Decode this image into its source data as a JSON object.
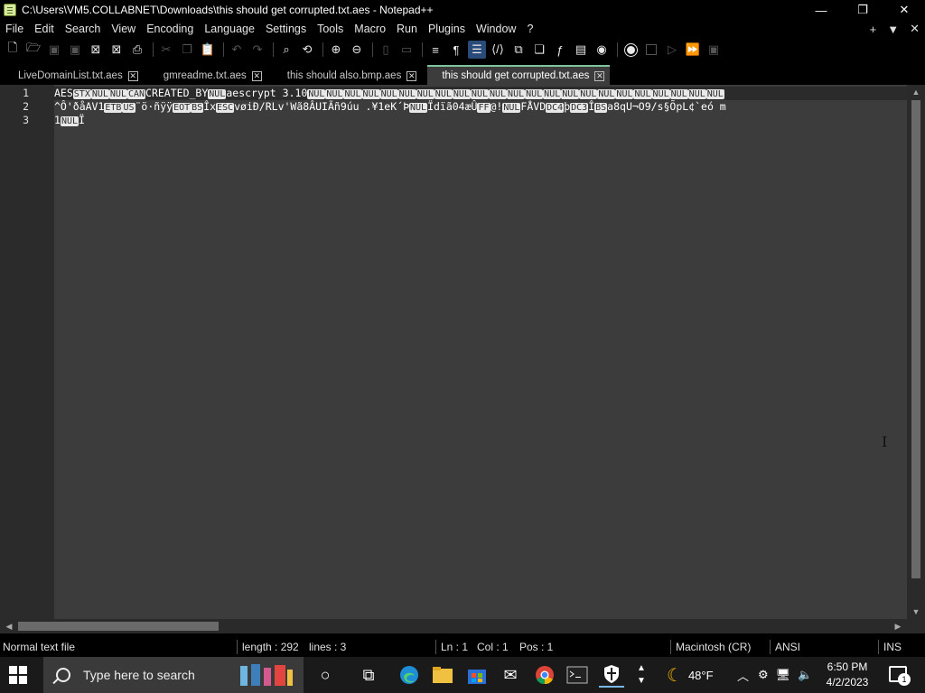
{
  "window": {
    "title": "C:\\Users\\VM5.COLLABNET\\Downloads\\this should get corrupted.txt.aes - Notepad++",
    "minimize_glyph": "—",
    "restore_glyph": "❐",
    "close_glyph": "✕"
  },
  "menu": {
    "items": [
      "File",
      "Edit",
      "Search",
      "View",
      "Encoding",
      "Language",
      "Settings",
      "Tools",
      "Macro",
      "Run",
      "Plugins",
      "Window",
      "?"
    ],
    "right": {
      "plus": "+",
      "dropdown": "▼",
      "close": "✕"
    }
  },
  "tabs": [
    {
      "label": "LiveDomainList.txt.aes",
      "active": false
    },
    {
      "label": "gmreadme.txt.aes",
      "active": false
    },
    {
      "label": "this should also.bmp.aes",
      "active": false
    },
    {
      "label": "this should get corrupted.txt.aes",
      "active": true
    }
  ],
  "editor": {
    "line_numbers": [
      "1",
      "2",
      "3"
    ],
    "lines": [
      {
        "segments": [
          {
            "t": "AES",
            "cc": false
          },
          {
            "t": "STX",
            "cc": true
          },
          {
            "t": "NUL",
            "cc": true
          },
          {
            "t": "NUL",
            "cc": true
          },
          {
            "t": "CAN",
            "cc": true
          },
          {
            "t": "CREATED_BY",
            "cc": false
          },
          {
            "t": "NUL",
            "cc": true
          },
          {
            "t": "aescrypt 3.10",
            "cc": false
          },
          {
            "t": "NUL",
            "cc": true
          },
          {
            "t": "NUL",
            "cc": true
          },
          {
            "t": "NUL",
            "cc": true
          },
          {
            "t": "NUL",
            "cc": true
          },
          {
            "t": "NUL",
            "cc": true
          },
          {
            "t": "NUL",
            "cc": true
          },
          {
            "t": "NUL",
            "cc": true
          },
          {
            "t": "NUL",
            "cc": true
          },
          {
            "t": "NUL",
            "cc": true
          },
          {
            "t": "NUL",
            "cc": true
          },
          {
            "t": "NUL",
            "cc": true
          },
          {
            "t": "NUL",
            "cc": true
          },
          {
            "t": "NUL",
            "cc": true
          },
          {
            "t": "NUL",
            "cc": true
          },
          {
            "t": "NUL",
            "cc": true
          },
          {
            "t": "NUL",
            "cc": true
          },
          {
            "t": "NUL",
            "cc": true
          },
          {
            "t": "NUL",
            "cc": true
          },
          {
            "t": "NUL",
            "cc": true
          },
          {
            "t": "NUL",
            "cc": true
          },
          {
            "t": "NUL",
            "cc": true
          },
          {
            "t": "NUL",
            "cc": true
          },
          {
            "t": "NUL",
            "cc": true
          }
        ]
      },
      {
        "segments": [
          {
            "t": "^Ô'ðåAV1",
            "cc": false
          },
          {
            "t": "ETB",
            "cc": true
          },
          {
            "t": "US",
            "cc": true
          },
          {
            "t": "¨ö·ñ",
            "cc": false
          },
          {
            "t": "ÿ",
            "cc": false
          },
          {
            "t": "ÿ",
            "cc": false
          },
          {
            "t": "EOT",
            "cc": true
          },
          {
            "t": "BS",
            "cc": true
          },
          {
            "t": "Îx",
            "cc": false
          },
          {
            "t": "ESC",
            "cc": true
          },
          {
            "t": "vøiÐ/RLv'",
            "cc": false
          },
          {
            "t": "W",
            "cc": false
          },
          {
            "t": "ã8ÂUI",
            "cc": false
          },
          {
            "t": "Ãñ9úu .¥1eK´Þ",
            "cc": false
          },
          {
            "t": "NUL",
            "cc": true
          },
          {
            "t": "Ïdïã04æÛ",
            "cc": false
          },
          {
            "t": "FF",
            "cc": true
          },
          {
            "t": "@!",
            "cc": false
          },
          {
            "t": "NUL",
            "cc": true
          },
          {
            "t": "FÅVD",
            "cc": false
          },
          {
            "t": "DC4",
            "cc": true
          },
          {
            "t": "þ",
            "cc": false
          },
          {
            "t": "DC3",
            "cc": true
          },
          {
            "t": "Î",
            "cc": false
          },
          {
            "t": "BS",
            "cc": true
          },
          {
            "t": "a8qU¬O9/s§ÕpL¢`eó   m",
            "cc": false
          }
        ]
      },
      {
        "segments": [
          {
            "t": "1",
            "cc": false
          },
          {
            "t": "NUL",
            "cc": true
          },
          {
            "t": "Ï",
            "cc": false
          }
        ]
      }
    ]
  },
  "statusbar": {
    "file_type": "Normal text file",
    "length": "length : 292",
    "lines": "lines : 3",
    "ln": "Ln : 1",
    "col": "Col : 1",
    "pos": "Pos : 1",
    "eol": "Macintosh (CR)",
    "encoding": "ANSI",
    "mode": "INS"
  },
  "taskbar": {
    "search_placeholder": "Type here to search",
    "weather": "48°F",
    "time": "6:50 PM",
    "date": "4/2/2023",
    "notification_count": "1"
  }
}
